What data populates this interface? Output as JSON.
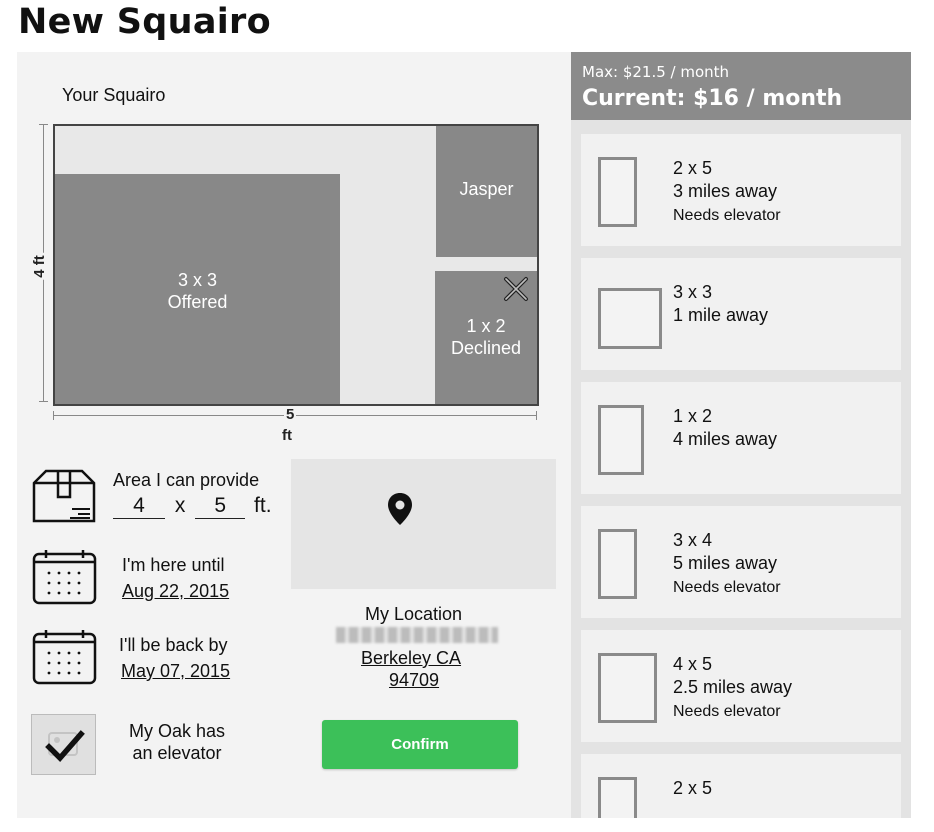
{
  "page": {
    "title": "New Squairo"
  },
  "plot_map": {
    "label": "Your Squairo",
    "height_label": "4 ft",
    "width_value": "5",
    "width_unit": "ft",
    "plots": [
      {
        "line1": "3 x 3",
        "line2": "Offered"
      },
      {
        "line1": "Jasper",
        "line2": ""
      },
      {
        "line1": "1 x 2",
        "line2": "Declined"
      }
    ]
  },
  "form": {
    "area_label": "Area I can provide",
    "area_width": "4",
    "area_x": "x",
    "area_height": "5",
    "area_unit": "ft.",
    "here_until_label": "I'm here until",
    "here_until_date": "Aug 22, 2015",
    "back_by_label": "I'll be back by",
    "back_by_date": "May 07, 2015",
    "elevator_line1": "My Oak has",
    "elevator_line2": "an elevator",
    "elevator_checked": true
  },
  "location": {
    "label": "My Location",
    "city": "Berkeley CA",
    "zip": "94709"
  },
  "confirm_button": "Confirm",
  "pricing": {
    "max": "Max: $21.5 / month",
    "current": "Current: $16 / month"
  },
  "requests": [
    {
      "size": "2 x 5",
      "distance": "3 miles away",
      "note": "Needs elevator"
    },
    {
      "size": "3 x 3",
      "distance": "1 mile away",
      "note": ""
    },
    {
      "size": "1 x 2",
      "distance": "4 miles away",
      "note": ""
    },
    {
      "size": "3 x 4",
      "distance": "5 miles away",
      "note": "Needs elevator"
    },
    {
      "size": "4 x 5",
      "distance": "2.5 miles away",
      "note": "Needs elevator"
    },
    {
      "size": "2 x 5",
      "distance": "",
      "note": ""
    }
  ],
  "colors": {
    "confirm": "#3cc059",
    "plot": "#888888",
    "header": "#8b8b8b"
  }
}
